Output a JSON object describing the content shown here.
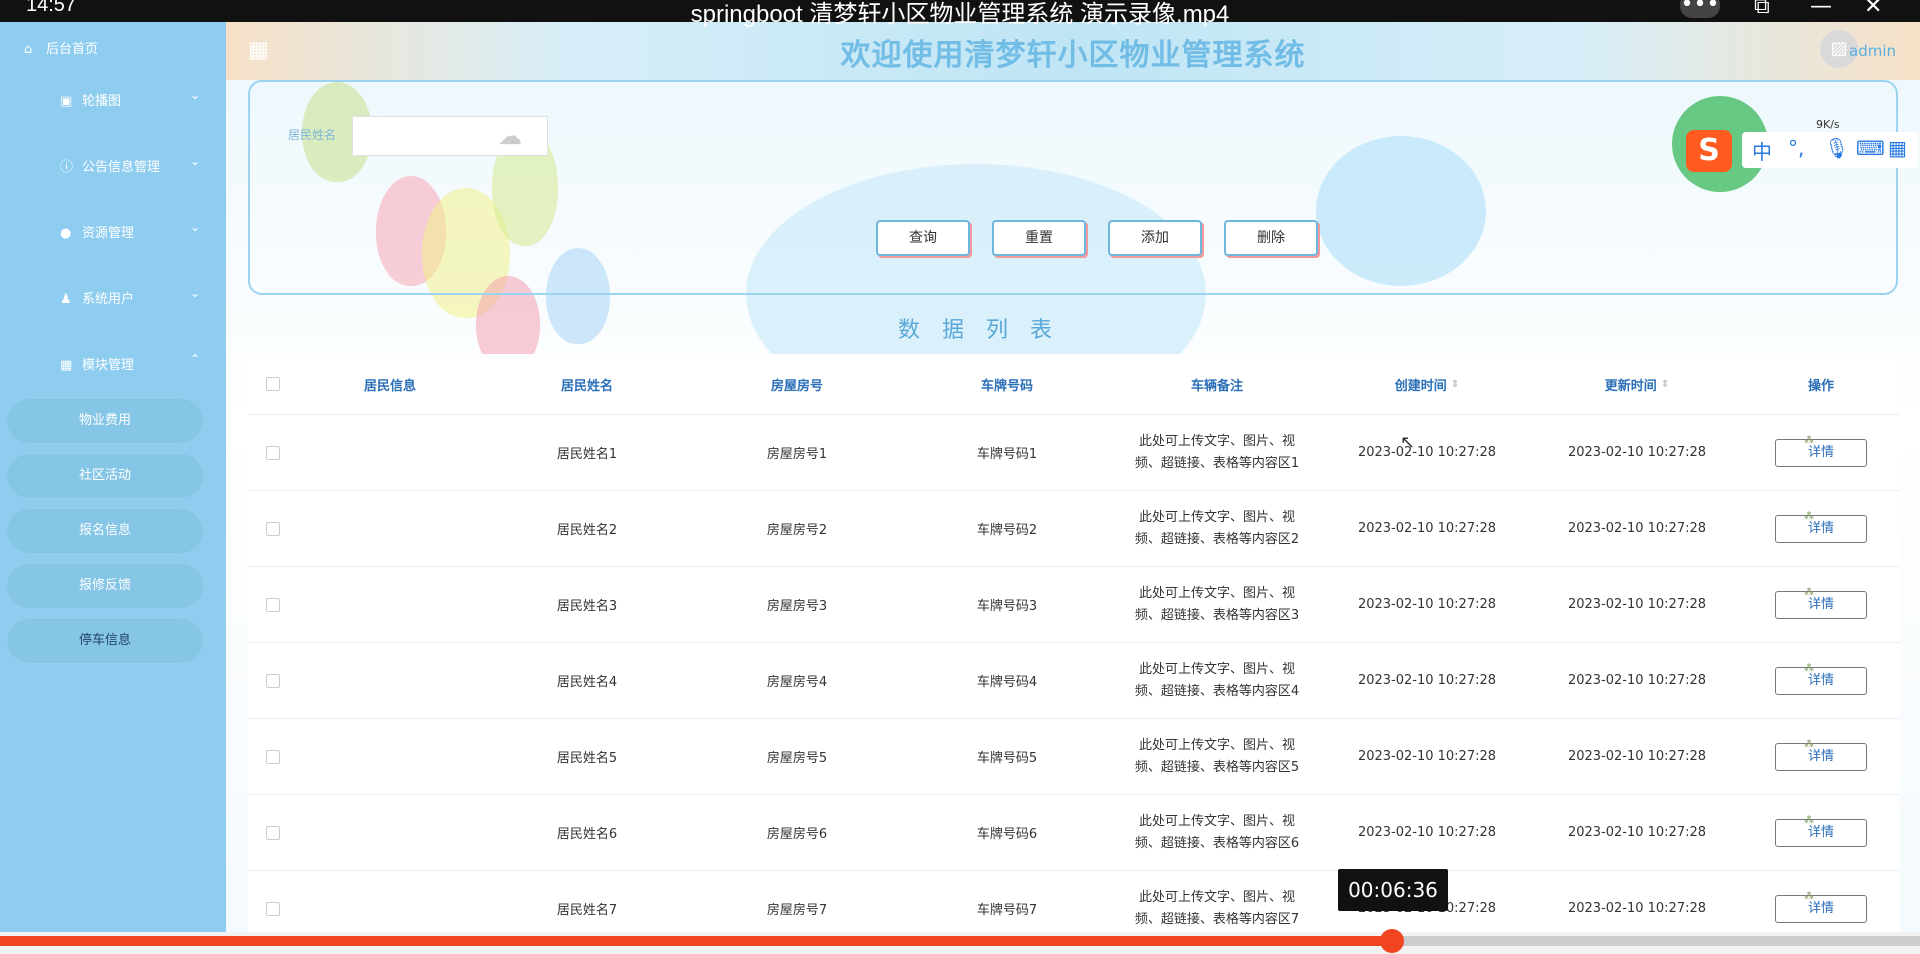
{
  "player": {
    "clock": "14:57",
    "title": "springboot 清梦轩小区物业管理系统 演示录像.mp4",
    "timecode": "00:06:36",
    "progress": 0.725
  },
  "sidebar": {
    "home": "后台首页",
    "menus": [
      {
        "label": "轮播图",
        "icon": "image-icon"
      },
      {
        "label": "公告信息管理",
        "icon": "info-icon"
      },
      {
        "label": "资源管理",
        "icon": "location-icon"
      },
      {
        "label": "系统用户",
        "icon": "user-icon"
      },
      {
        "label": "模块管理",
        "icon": "grid-icon"
      }
    ],
    "subitems": [
      "物业费用",
      "社区活动",
      "报名信息",
      "报修反馈",
      "停车信息"
    ]
  },
  "header": {
    "title": "欢迎使用清梦轩小区物业管理系统",
    "user": "admin"
  },
  "search": {
    "label": "居民姓名",
    "placeholder": "",
    "buttons": {
      "query": "查询",
      "reset": "重置",
      "add": "添加",
      "delete": "删除"
    }
  },
  "list_title": "数据列表",
  "table": {
    "columns": [
      "居民信息",
      "居民姓名",
      "房屋房号",
      "车牌号码",
      "车辆备注",
      "创建时间",
      "更新时间",
      "操作"
    ],
    "detail_label": "详情",
    "rows": [
      {
        "name": "居民姓名1",
        "room": "房屋房号1",
        "plate": "车牌号码1",
        "note_line1": "此处可上传文字、图片、视",
        "note_line2": "频、超链接、表格等内容区1",
        "created": "2023-02-10 10:27:28",
        "updated": "2023-02-10 10:27:28"
      },
      {
        "name": "居民姓名2",
        "room": "房屋房号2",
        "plate": "车牌号码2",
        "note_line1": "此处可上传文字、图片、视",
        "note_line2": "频、超链接、表格等内容区2",
        "created": "2023-02-10 10:27:28",
        "updated": "2023-02-10 10:27:28"
      },
      {
        "name": "居民姓名3",
        "room": "房屋房号3",
        "plate": "车牌号码3",
        "note_line1": "此处可上传文字、图片、视",
        "note_line2": "频、超链接、表格等内容区3",
        "created": "2023-02-10 10:27:28",
        "updated": "2023-02-10 10:27:28"
      },
      {
        "name": "居民姓名4",
        "room": "房屋房号4",
        "plate": "车牌号码4",
        "note_line1": "此处可上传文字、图片、视",
        "note_line2": "频、超链接、表格等内容区4",
        "created": "2023-02-10 10:27:28",
        "updated": "2023-02-10 10:27:28"
      },
      {
        "name": "居民姓名5",
        "room": "房屋房号5",
        "plate": "车牌号码5",
        "note_line1": "此处可上传文字、图片、视",
        "note_line2": "频、超链接、表格等内容区5",
        "created": "2023-02-10 10:27:28",
        "updated": "2023-02-10 10:27:28"
      },
      {
        "name": "居民姓名6",
        "room": "房屋房号6",
        "plate": "车牌号码6",
        "note_line1": "此处可上传文字、图片、视",
        "note_line2": "频、超链接、表格等内容区6",
        "created": "2023-02-10 10:27:28",
        "updated": "2023-02-10 10:27:28"
      },
      {
        "name": "居民姓名7",
        "room": "房屋房号7",
        "plate": "车牌号码7",
        "note_line1": "此处可上传文字、图片、视",
        "note_line2": "频、超链接、表格等内容区7",
        "created": "2023-02-10 10:27:28",
        "updated": "2023-02-10 10:27:28"
      }
    ]
  },
  "ime": {
    "mode": "中",
    "speed": "9K/s"
  }
}
